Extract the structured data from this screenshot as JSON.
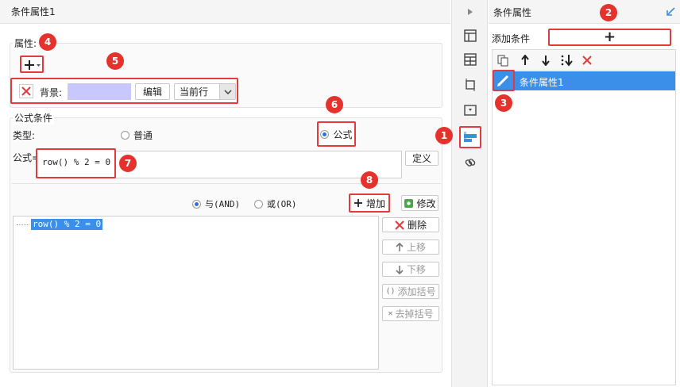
{
  "dialog": {
    "title": "条件属性1",
    "attribute_group_label": "属性:",
    "attribute_row": {
      "name": "背景:",
      "color": "#c8c8ff",
      "edit_button": "编辑",
      "scope_select": "当前行"
    },
    "formula_group_label": "公式条件",
    "type_label": "类型:",
    "type_options": {
      "normal": "普通",
      "formula": "公式"
    },
    "formula_label": "公式=",
    "formula_value": "row() % 2 = 0",
    "define_button": "定义",
    "logic_options": {
      "and": "与(AND)",
      "or": "或(OR)"
    },
    "add_button": "增加",
    "modify_button": "修改",
    "condition_list": [
      "row() % 2 = 0"
    ],
    "side_buttons": {
      "delete": "删除",
      "up": "上移",
      "down": "下移",
      "add_bracket": "添加括号",
      "remove_bracket": "去掉括号"
    }
  },
  "right_panel": {
    "title": "条件属性",
    "add_condition_label": "添加条件",
    "add_button_symbol": "+",
    "items": [
      "条件属性1"
    ]
  },
  "badges": {
    "b1": "1",
    "b2": "2",
    "b3": "3",
    "b4": "4",
    "b5": "5",
    "b6": "6",
    "b7": "7",
    "b8": "8"
  },
  "colors": {
    "accent": "#3c8fe8",
    "selected_row": "#3c8fe8",
    "red": "#e23b3b"
  }
}
